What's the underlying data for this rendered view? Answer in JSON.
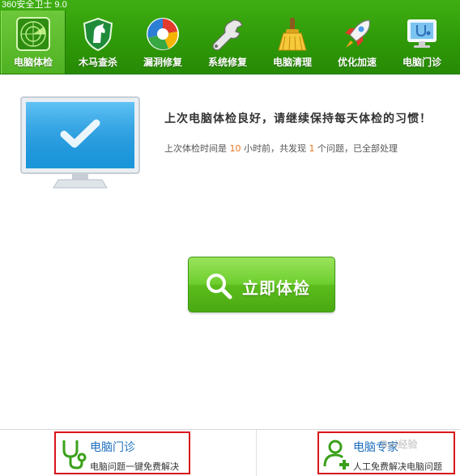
{
  "app": {
    "title": "360安全卫士 9.0"
  },
  "tabs": [
    {
      "label": "电脑体检",
      "icon": "radar-icon",
      "active": true
    },
    {
      "label": "木马查杀",
      "icon": "horse-shield-icon",
      "active": false
    },
    {
      "label": "漏洞修复",
      "icon": "patch-ball-icon",
      "active": false
    },
    {
      "label": "系统修复",
      "icon": "wrench-icon",
      "active": false
    },
    {
      "label": "电脑清理",
      "icon": "broom-icon",
      "active": false
    },
    {
      "label": "优化加速",
      "icon": "rocket-icon",
      "active": false
    },
    {
      "label": "电脑门诊",
      "icon": "monitor-stethoscope-icon",
      "active": false
    }
  ],
  "main": {
    "headline": "上次电脑体检良好，请继续保持每天体检的习惯！",
    "status_prefix": "上次体检时间是",
    "status_hours": "10",
    "status_mid": "小时前，共发现",
    "status_issues": "1",
    "status_suffix": "个问题，已全部处理",
    "scan_button": "立即体检"
  },
  "bottom": {
    "clinic": {
      "title": "电脑门诊",
      "desc": "电脑问题一键免费解决"
    },
    "expert": {
      "title": "电脑专家",
      "desc": "人工免费解决电脑问题"
    }
  },
  "watermark": "Bai经验",
  "colors": {
    "brand_green": "#2f9a08",
    "button_green": "#5bbd1c",
    "highlight_orange": "#e8731a",
    "link_blue": "#1d6fbf",
    "annotation_red": "#d9161a"
  }
}
